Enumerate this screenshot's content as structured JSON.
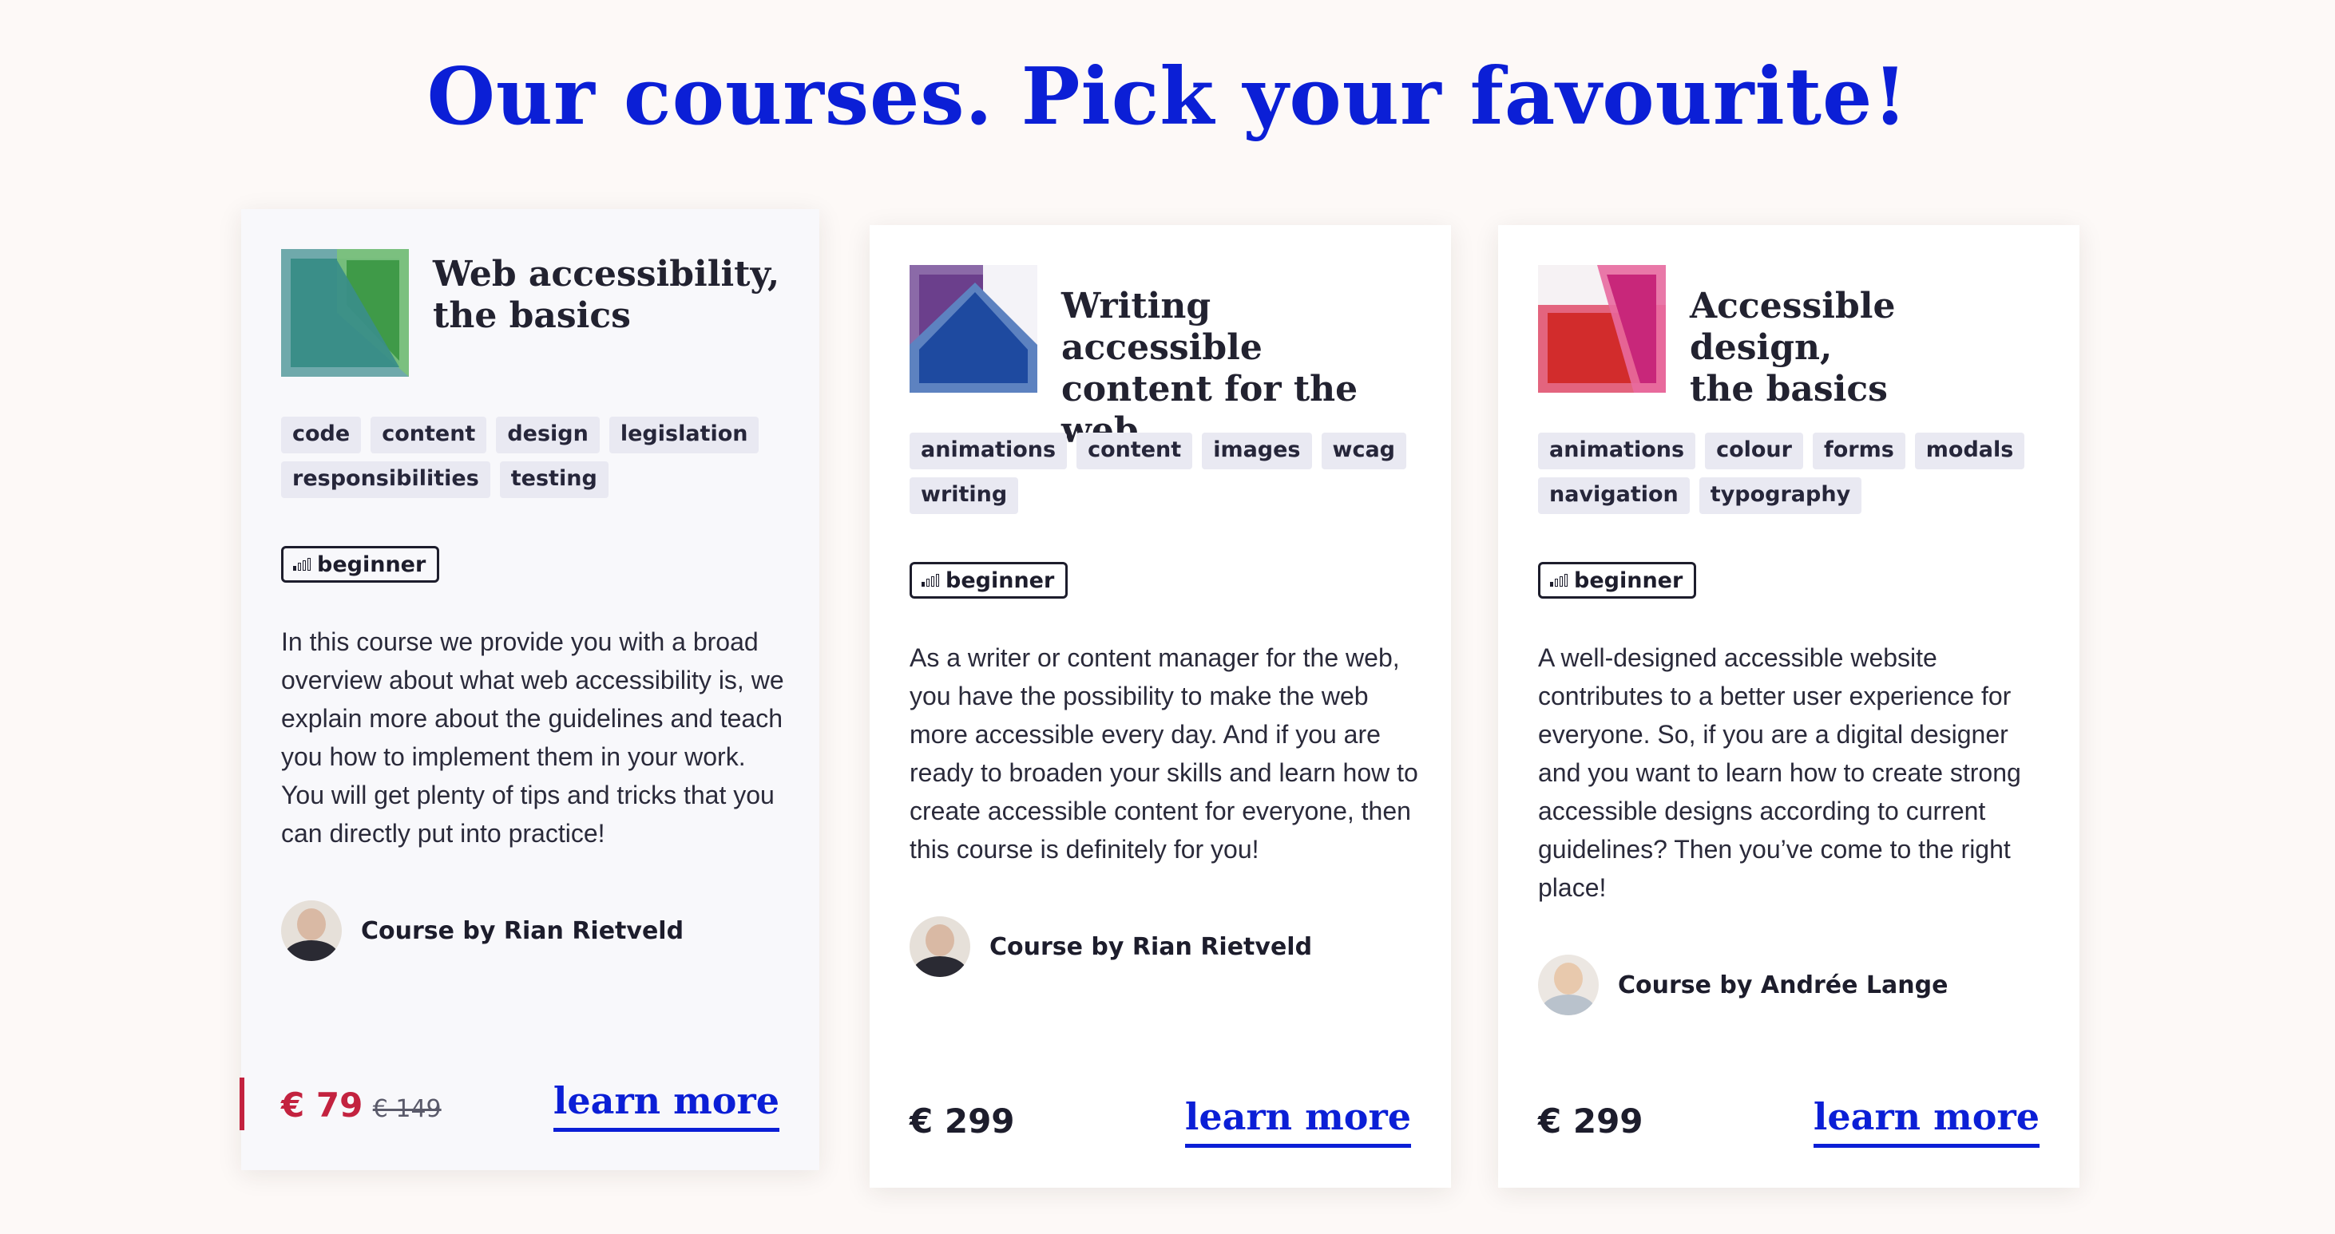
{
  "heading": "Our courses. Pick your favourite!",
  "colors": {
    "accent": "#0b1fd6",
    "sale": "#c3223f",
    "tag_bg": "#e9e9f2"
  },
  "courses": [
    {
      "title_line1": "Web accessibility,",
      "title_line2": "the basics",
      "thumbnail": "green-teal-geometric-thumbnail",
      "tags": [
        "code",
        "content",
        "design",
        "legislation",
        "responsibilities",
        "testing"
      ],
      "level": "beginner",
      "level_icon": "signal-bars-icon",
      "description": "In this course we provide you with a broad overview about what web accessibility is, we explain more about the guidelines and teach you how to implement them in your work. You will get plenty of tips and tricks that you can directly put into practice!",
      "author": "Course by Rian Rietveld",
      "price": "€ 79",
      "old_price": "€ 149",
      "cta": "learn more"
    },
    {
      "title_line1": "Writing accessible",
      "title_line2": "content for the web",
      "thumbnail": "blue-purple-geometric-thumbnail",
      "tags": [
        "animations",
        "content",
        "images",
        "wcag",
        "writing"
      ],
      "level": "beginner",
      "level_icon": "signal-bars-icon",
      "description": "As a writer or content manager for the web, you have the possibility to make the web more accessible every day. And if you are ready to broaden your skills and learn how to create accessible content for everyone, then this course is definitely for you!",
      "author": "Course by Rian Rietveld",
      "price": "€ 299",
      "cta": "learn more"
    },
    {
      "title_line1": "Accessible design,",
      "title_line2": "the basics",
      "thumbnail": "red-pink-geometric-thumbnail",
      "tags": [
        "animations",
        "colour",
        "forms",
        "modals",
        "navigation",
        "typography"
      ],
      "level": "beginner",
      "level_icon": "signal-bars-icon",
      "description": "A well-designed accessible website contributes to a better user experience for everyone. So, if you are a digital designer and you want to learn how to create strong accessible designs according to current guidelines? Then you’ve come to the right place!",
      "author": "Course by Andrée Lange",
      "price": "€ 299",
      "cta": "learn more"
    }
  ]
}
